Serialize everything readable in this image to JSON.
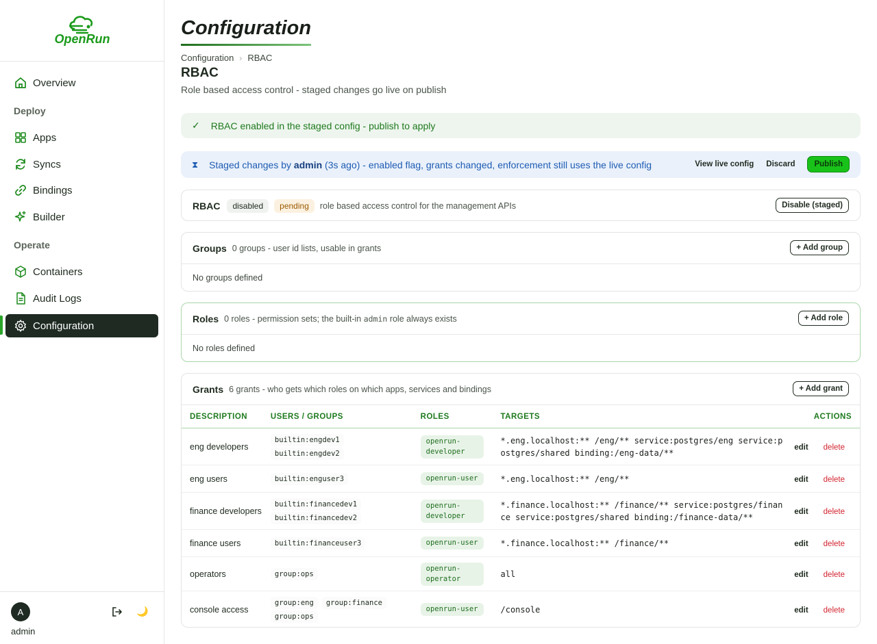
{
  "brand": {
    "name": "OpenRun"
  },
  "sidebar": {
    "items": [
      {
        "label": "Overview",
        "icon": "home-icon"
      },
      {
        "label": "Apps",
        "icon": "grid-icon"
      },
      {
        "label": "Syncs",
        "icon": "sync-icon"
      },
      {
        "label": "Bindings",
        "icon": "link-icon"
      },
      {
        "label": "Builder",
        "icon": "sparkle-icon"
      },
      {
        "label": "Containers",
        "icon": "cube-icon"
      },
      {
        "label": "Audit Logs",
        "icon": "document-icon"
      },
      {
        "label": "Configuration",
        "icon": "gear-icon",
        "active": true
      }
    ],
    "sections": {
      "deploy": "Deploy",
      "operate": "Operate"
    },
    "user": {
      "initial": "A",
      "name": "admin"
    }
  },
  "page": {
    "title": "Configuration",
    "breadcrumb": [
      "Configuration",
      "RBAC"
    ],
    "section_title": "RBAC",
    "section_subtitle": "Role based access control - staged changes go live on publish"
  },
  "success_banner": {
    "text": "RBAC enabled in the staged config - publish to apply"
  },
  "staged_banner": {
    "prefix": "Staged changes by",
    "user": "admin",
    "suffix": "(3s ago) - enabled flag, grants changed, enforcement still uses the live config",
    "view_live": "View live config",
    "discard": "Discard",
    "publish": "Publish"
  },
  "rbac_card": {
    "title": "RBAC",
    "status": "disabled",
    "badge": "pending",
    "description": "role based access control for the management APIs",
    "button": "Disable (staged)"
  },
  "groups_card": {
    "title": "Groups",
    "subtitle": "0 groups - user id lists, usable in grants",
    "button": "+ Add group",
    "empty": "No groups defined"
  },
  "roles_card": {
    "title": "Roles",
    "subtitle_pre": "0 roles - permission sets; the built-in",
    "subtitle_code": "admin",
    "subtitle_post": "role always exists",
    "button": "+ Add role",
    "empty": "No roles defined"
  },
  "grants_card": {
    "title": "Grants",
    "subtitle": "6 grants - who gets which roles on which apps, services and bindings",
    "button": "+ Add grant",
    "columns": [
      "DESCRIPTION",
      "USERS / GROUPS",
      "ROLES",
      "TARGETS",
      "ACTIONS"
    ],
    "edit_label": "edit",
    "delete_label": "delete",
    "rows": [
      {
        "description": "eng developers",
        "users": [
          "builtin:engdev1",
          "builtin:engdev2"
        ],
        "role": "openrun-developer",
        "targets": "*.eng.localhost:** /eng/** service:postgres/eng service:postgres/shared binding:/eng-data/**"
      },
      {
        "description": "eng users",
        "users": [
          "builtin:enguser3"
        ],
        "role": "openrun-user",
        "targets": "*.eng.localhost:** /eng/**"
      },
      {
        "description": "finance developers",
        "users": [
          "builtin:financedev1",
          "builtin:financedev2"
        ],
        "role": "openrun-developer",
        "targets": "*.finance.localhost:** /finance/** service:postgres/finance service:postgres/shared binding:/finance-data/**"
      },
      {
        "description": "finance users",
        "users": [
          "builtin:financeuser3"
        ],
        "role": "openrun-user",
        "targets": "*.finance.localhost:** /finance/**"
      },
      {
        "description": "operators",
        "users": [
          "group:ops"
        ],
        "role": "openrun-operator",
        "targets": "all"
      },
      {
        "description": "console access",
        "users": [
          "group:eng",
          "group:finance",
          "group:ops"
        ],
        "role": "openrun-user",
        "targets": "/console"
      }
    ]
  }
}
